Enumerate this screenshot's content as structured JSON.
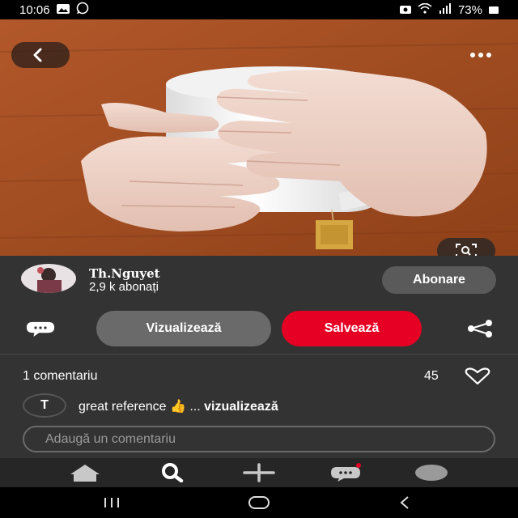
{
  "status_bar": {
    "time": "10:06",
    "battery": "73%"
  },
  "pin": {
    "icons": {
      "back": "back-arrow-icon",
      "more": "more-dots-icon",
      "visual_search": "visual-search-icon"
    }
  },
  "author": {
    "name": "Th.Nguyet",
    "followers": "2,9 k abonați",
    "follow_label": "Abonare"
  },
  "actions": {
    "view_label": "Vizualizează",
    "save_label": "Salvează",
    "accent_color": "#e60023"
  },
  "comments": {
    "count_label": "1 comentariu",
    "likes": "45",
    "items": [
      {
        "avatar_letter": "T",
        "text": "great reference 👍 ...",
        "more_label": "vizualizează"
      }
    ],
    "input_placeholder": "Adaugă un comentariu"
  },
  "bottom_nav": {
    "items": [
      "home-icon",
      "search-icon",
      "create-icon",
      "messages-icon",
      "profile-avatar"
    ]
  }
}
